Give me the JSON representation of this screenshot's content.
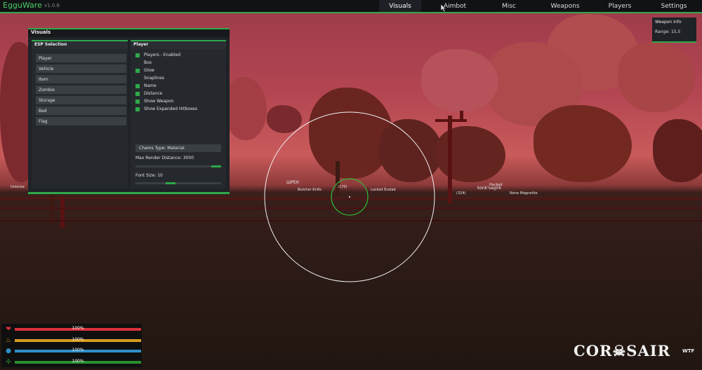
{
  "app": {
    "brand": "EgguWare",
    "version": "v1.0.6"
  },
  "nav": {
    "tabs": [
      {
        "label": "Visuals",
        "active": true
      },
      {
        "label": "Aimbot",
        "active": false
      },
      {
        "label": "Misc",
        "active": false
      },
      {
        "label": "Weapons",
        "active": false
      },
      {
        "label": "Players",
        "active": false
      },
      {
        "label": "Settings",
        "active": false
      }
    ]
  },
  "visuals_window": {
    "title": "Visuals",
    "esp_selection": {
      "title": "ESP Selection",
      "items": [
        "Player",
        "Vehicle",
        "Item",
        "Zombie",
        "Storage",
        "Bed",
        "Flag"
      ]
    },
    "player_panel": {
      "title": "Player",
      "options": [
        {
          "label": "Players - Enabled",
          "checked": true
        },
        {
          "label": "Box",
          "checked": false
        },
        {
          "label": "Glow",
          "checked": true
        },
        {
          "label": "Snaplines",
          "checked": false
        },
        {
          "label": "Name",
          "checked": true
        },
        {
          "label": "Distance",
          "checked": true
        },
        {
          "label": "Show Weapon",
          "checked": true
        },
        {
          "label": "Show Expanded Hitboxes",
          "checked": true
        }
      ],
      "chams_type": "Chams Type: Material",
      "max_render_label": "Max Render Distance: 3000",
      "max_render_fraction": 1.0,
      "font_size_label": "Font Size: 10",
      "font_size_fraction": 0.4
    }
  },
  "weapon_info": {
    "title": "Weapon Info",
    "range": "Range: 15,5"
  },
  "esp_labels": [
    "Unlocke",
    "ШРЕК",
    "Butcher Knife",
    "Locked Ecolab",
    "konk'sagirk",
    "Hacked",
    "None Magnetite",
    "(170)",
    "(324)"
  ],
  "hud": {
    "stats": [
      {
        "icon": "heart-icon",
        "glyph": "❤",
        "value": "100%",
        "color": "#d8313a",
        "level": 1.0
      },
      {
        "icon": "food-icon",
        "glyph": "♨",
        "value": "100%",
        "color": "#d89c1e",
        "level": 1.0
      },
      {
        "icon": "water-icon",
        "glyph": "●",
        "value": "100%",
        "color": "#2f8fc7",
        "level": 1.0
      },
      {
        "icon": "virus-icon",
        "glyph": "✣",
        "value": "100%",
        "color": "#2a8f2e",
        "level": 1.0
      }
    ]
  },
  "watermark": {
    "text": "COR☠SAIR",
    "sub": "WTF"
  },
  "colors": {
    "accent": "#2fa84a"
  }
}
